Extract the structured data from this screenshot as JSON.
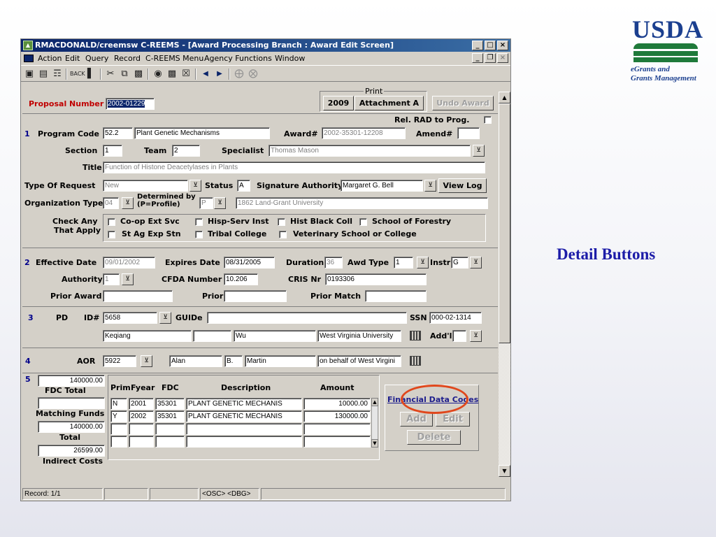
{
  "slide": {
    "logo_text": "USDA",
    "logo_sub_line1": "eGrants and",
    "logo_sub_line2": "Grants Management",
    "caption": "Detail Buttons"
  },
  "window": {
    "title": "RMACDONALD/creemsw  C-REEMS - [Award Processing Branch : Award Edit Screen]",
    "menu": [
      "Action",
      "Edit",
      "Query",
      "Record",
      "C-REEMS Menu",
      "Agency Functions",
      "Window"
    ]
  },
  "header": {
    "proposal_label": "Proposal Number",
    "proposal_value": "2002-01229",
    "print_label": "Print",
    "btn_2009": "2009",
    "btn_attachment": "Attachment A",
    "btn_undo": "Undo Award",
    "rel_rad_label": "Rel. RAD to Prog."
  },
  "section1": {
    "num": "1",
    "program_code_label": "Program Code",
    "program_code": "52.2",
    "program_name": "Plant Genetic Mechanisms",
    "award_label": "Award#",
    "award_value": "2002-35301-12208",
    "amend_label": "Amend#",
    "amend_value": "",
    "section_label": "Section",
    "section_value": "1",
    "team_label": "Team",
    "team_value": "2",
    "specialist_label": "Specialist",
    "specialist_value": "Thomas Mason",
    "title_label": "Title",
    "title_value": "Function of Histone Deacetylases in Plants",
    "type_request_label": "Type Of Request",
    "type_request_value": "New",
    "status_label": "Status",
    "status_value": "A",
    "sig_auth_label": "Signature Authority",
    "sig_auth_value": "Margaret G. Bell",
    "view_log_btn": "View Log",
    "org_type_label": "Organization Type",
    "org_type_value": "04",
    "determined_label_1": "Determined by",
    "determined_label_2": "(P=Profile)",
    "determined_value": "P",
    "org_desc": "1862 Land-Grant University",
    "check_any_1": "Check Any",
    "check_any_2": "That Apply",
    "checks": [
      "Co-op Ext Svc",
      "Hisp-Serv Inst",
      "Hist Black Coll",
      "School of Forestry",
      "St Ag Exp Stn",
      "Tribal College",
      "Veterinary School or College"
    ]
  },
  "section2": {
    "num": "2",
    "eff_date_label": "Effective Date",
    "eff_date": "09/01/2002",
    "exp_date_label": "Expires Date",
    "exp_date": "08/31/2005",
    "duration_label": "Duration",
    "duration": "36",
    "awd_type_label": "Awd Type",
    "awd_type": "1",
    "instr_label": "Instr",
    "instr": "G",
    "authority_label": "Authority",
    "authority": "1",
    "cfda_label": "CFDA Number",
    "cfda": "10.206",
    "cris_label": "CRIS Nr",
    "cris": "0193306",
    "prior_award_label": "Prior Award",
    "prior_award": "",
    "prior_dollar_label": "Prior $",
    "prior_dollar": "",
    "prior_match_label": "Prior Match",
    "prior_match": ""
  },
  "section3": {
    "num": "3",
    "pd_label": "PD",
    "id_label": "ID#",
    "id_value": "5658",
    "guide_label": "GUIDe",
    "guide_value": "",
    "ssn_label": "SSN",
    "ssn_value": "000-02-1314",
    "first_name": "Keqiang",
    "middle": "",
    "last_name": "Wu",
    "institution": "West Virginia University",
    "addl_label": "Add'l"
  },
  "section4": {
    "num": "4",
    "aor_label": "AOR",
    "aor_id": "5922",
    "first": "Alan",
    "middle": "B.",
    "last": "Martin",
    "behalf": "on behalf of West Virgini"
  },
  "section5": {
    "num": "5",
    "fdc_total_value": "140000.00",
    "fdc_total_label": "FDC Total",
    "matching_value": "",
    "matching_label": "Matching Funds",
    "total_value": "140000.00",
    "total_label": "Total",
    "indirect_value": "26599.00",
    "indirect_label": "Indirect Costs",
    "columns": [
      "Prim",
      "Fyear",
      "FDC",
      "Description",
      "Amount"
    ],
    "rows": [
      [
        "N",
        "2001",
        "35301",
        "PLANT GENETIC MECHANIS",
        "10000.00"
      ],
      [
        "Y",
        "2002",
        "35301",
        "PLANT GENETIC MECHANIS",
        "130000.00"
      ],
      [
        "",
        "",
        "",
        "",
        ""
      ],
      [
        "",
        "",
        "",
        "",
        ""
      ]
    ],
    "fin_codes_label": "Financial Data Codes",
    "add_btn": "Add",
    "edit_btn": "Edit",
    "delete_btn": "Delete"
  },
  "statusbar": {
    "record": "Record: 1/1",
    "osc": "<OSC> <DBG>"
  },
  "colors": {
    "highlight_ring": "#e0471c",
    "title_bar": "#0a246a",
    "caption": "#1c1ca8"
  }
}
